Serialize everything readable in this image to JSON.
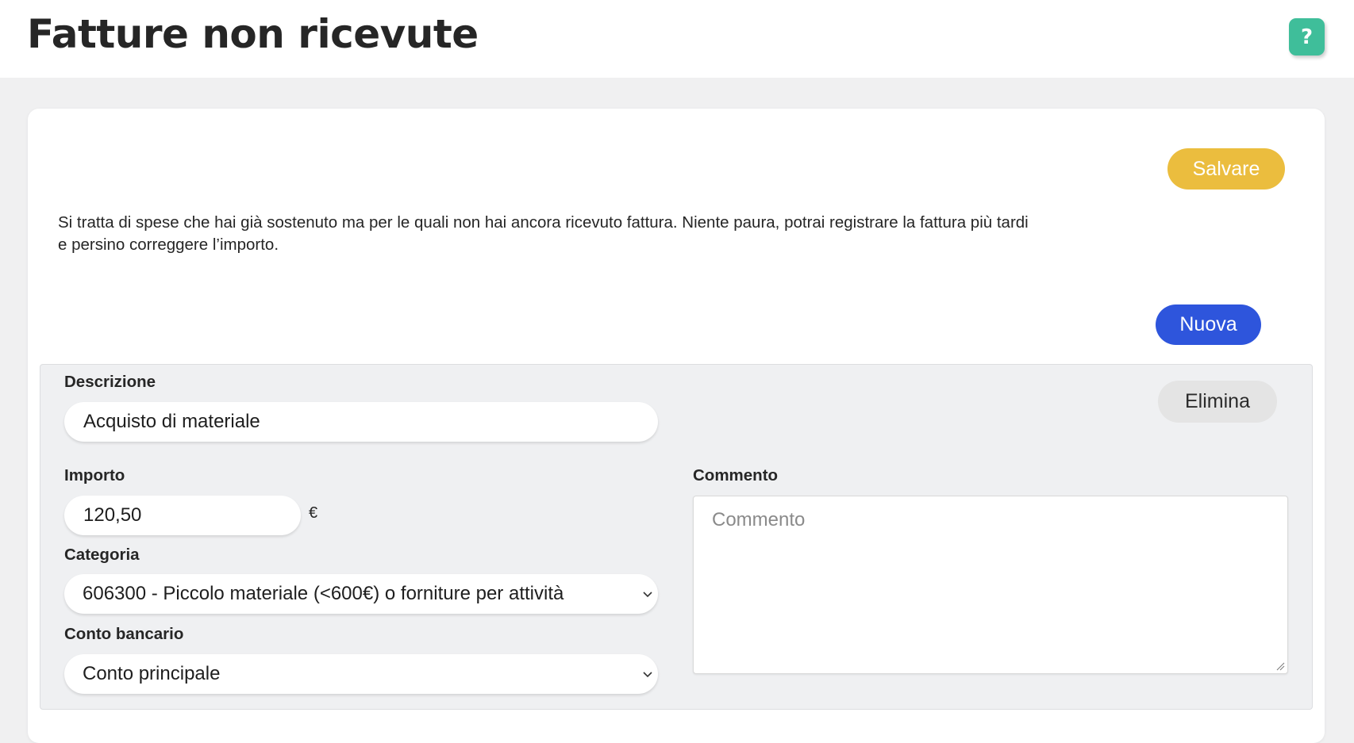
{
  "header": {
    "title": "Fatture non ricevute",
    "help_label": "?"
  },
  "toolbar": {
    "save_label": "Salvare",
    "new_label": "Nuova"
  },
  "intro": {
    "text": "Si tratta di spese che hai già sostenuto ma per le quali non hai ancora ricevuto fattura. Niente paura, potrai registrare la fattura più tardi e persino correggere l’importo."
  },
  "expense": {
    "delete_label": "Elimina",
    "description_label": "Descrizione",
    "description_value": "Acquisto di materiale",
    "amount_label": "Importo",
    "amount_value": "120,50",
    "currency_symbol": "€",
    "category_label": "Categoria",
    "category_value": "606300 - Piccolo materiale (<600€) o forniture per attività",
    "bank_account_label": "Conto bancario",
    "bank_account_value": "Conto principale",
    "comment_label": "Commento",
    "comment_placeholder": "Commento",
    "comment_value": ""
  },
  "colors": {
    "save_button": "#ebbd3e",
    "new_button": "#2e55dc",
    "help_button": "#3fbe9a",
    "delete_button": "#e4e4e4"
  }
}
